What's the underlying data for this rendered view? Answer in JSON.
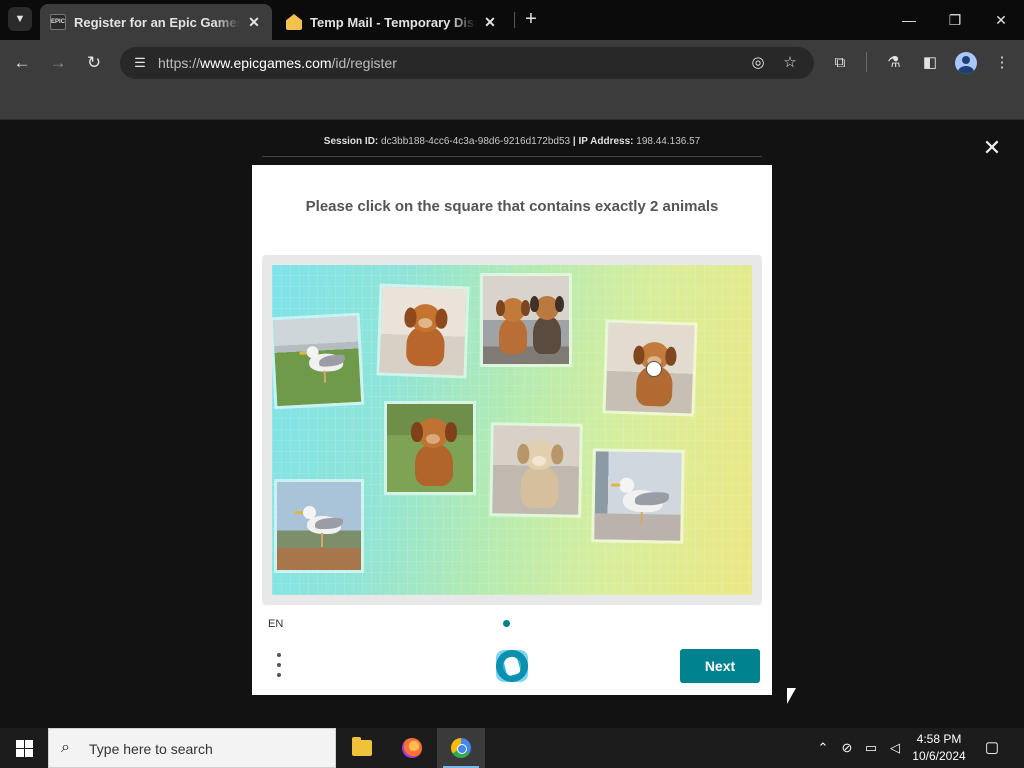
{
  "browser": {
    "tabs": [
      {
        "title": "Register for an Epic Games account",
        "favicon": "epic-games-icon",
        "active": true
      },
      {
        "title": "Temp Mail - Temporary Disposable Email",
        "favicon": "temp-mail-icon",
        "active": false
      }
    ],
    "url_prefix": "https://",
    "url_host": "www.epicgames.com",
    "url_path": "/id/register"
  },
  "page": {
    "session_label": "Session ID:",
    "session_id": "dc3bb188-4cc6-4c3a-98d6-9216d172bd53",
    "separator": "|",
    "ip_label": "IP Address:",
    "ip_value": "198.44.136.57"
  },
  "captcha": {
    "prompt": "Please click on the square that contains exactly 2 animals",
    "tiles": [
      {
        "name": "seagull-grass",
        "content": "1 seagull"
      },
      {
        "name": "puppy-sofa",
        "content": "1 puppy"
      },
      {
        "name": "two-puppies",
        "content": "2 puppies"
      },
      {
        "name": "puppy-room",
        "content": "1 puppy"
      },
      {
        "name": "puppy-grass",
        "content": "1 puppy"
      },
      {
        "name": "puppy-living-room",
        "content": "1 puppy"
      },
      {
        "name": "seagull-window",
        "content": "1 seagull"
      },
      {
        "name": "seagull-shore",
        "content": "1 seagull"
      }
    ],
    "language": "EN",
    "next_label": "Next",
    "accent": "#00838f"
  },
  "taskbar": {
    "search_placeholder": "Type here to search",
    "time": "4:58 PM",
    "date": "10/6/2024"
  }
}
